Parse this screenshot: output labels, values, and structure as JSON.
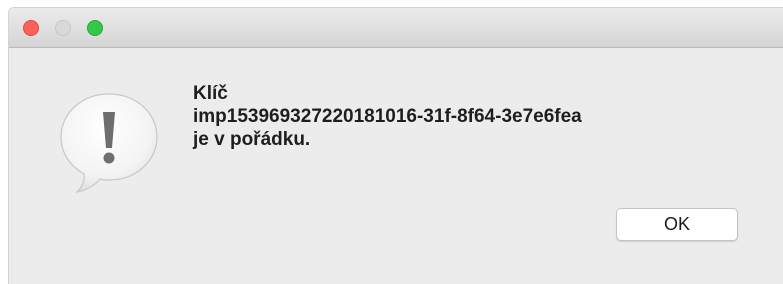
{
  "window": {
    "traffic_lights": {
      "close_color": "#fc605b",
      "minimize_color": "#d9d9d9",
      "zoom_color": "#34c84a"
    }
  },
  "alert": {
    "icon": "caution-speech-bubble-icon",
    "message_lines": [
      "Klíč",
      "imp15396932722018101­6-31f-8f64-3e7e6fea",
      "je v pořádku."
    ]
  },
  "buttons": {
    "ok_label": "OK"
  }
}
